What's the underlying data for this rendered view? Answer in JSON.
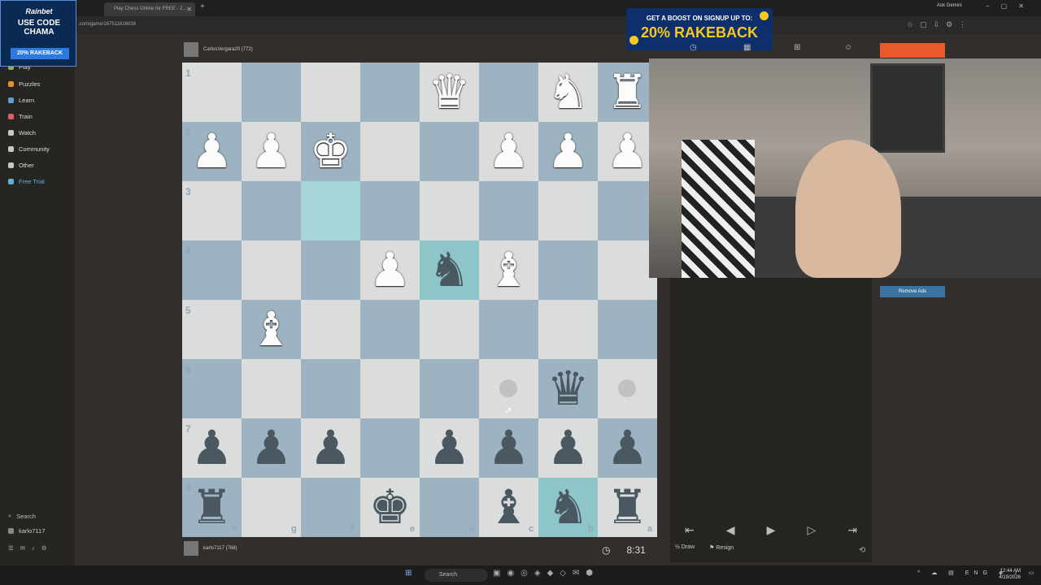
{
  "browser": {
    "active_tab": "Play Chess Online for FREE - 2...",
    "url": ".com/game/167511616038",
    "ask_gemini": "Ask Gemini"
  },
  "ads": {
    "corner_brand": "Rainbet",
    "corner_line1": "USE CODE",
    "corner_line2": "CHAMA",
    "corner_boost": "20% RAKEBACK",
    "rake_line1": "GET A BOOST ON SIGNUP UP TO:",
    "rake_line2": "20% RAKEBACK",
    "remove_ads": "Remove Ads"
  },
  "sidebar": {
    "items": [
      {
        "label": "Play",
        "color": "#81b64c"
      },
      {
        "label": "Puzzles",
        "color": "#e6912c"
      },
      {
        "label": "Learn",
        "color": "#5d9fd3"
      },
      {
        "label": "Train",
        "color": "#e25c5c"
      },
      {
        "label": "Watch",
        "color": "#c7c7c7"
      },
      {
        "label": "Community",
        "color": "#c7c7c7"
      },
      {
        "label": "Other",
        "color": "#c7c7c7"
      },
      {
        "label": "Free Trial",
        "color": "#5fb0e0"
      }
    ],
    "search": "Search",
    "user": "karlo7117"
  },
  "players": {
    "top": "CarlosVergara20 (772)",
    "bottom": "karlo7117 (768)"
  },
  "clock": {
    "time": "8:31"
  },
  "board": {
    "ranks": [
      "1",
      "2",
      "3",
      "4",
      "5",
      "6",
      "7",
      "8"
    ],
    "files": [
      "h",
      "g",
      "f",
      "e",
      "d",
      "c",
      "b",
      "a"
    ]
  },
  "controls": {
    "draw": "Draw",
    "resign": "Resign"
  },
  "taskbar": {
    "search": "Search",
    "lang": "ENG",
    "time": "12:44 AM",
    "date": "4/19/2026"
  }
}
